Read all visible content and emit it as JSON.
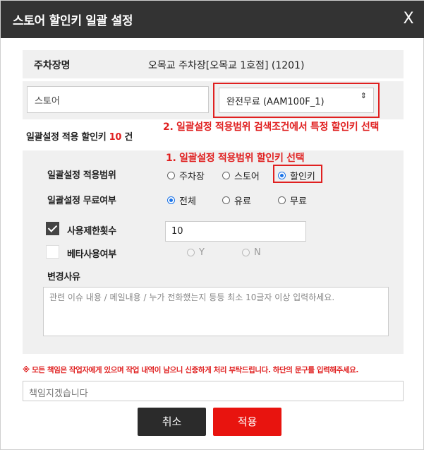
{
  "dialog": {
    "title": "스토어 할인키 일괄 설정",
    "close_label": "X"
  },
  "parking_lot": {
    "label": "주차장명",
    "value": "오목교 주차장[오목교 1호점] (1201)"
  },
  "filter": {
    "store_input_value": "스토어",
    "discount_select_value": "완전무료 (AAM100F_1)",
    "select_arrow": "⇕"
  },
  "annotations": {
    "step2": "2. 일괄설정 적용범위 검색조건에서 특정 할인키 선택",
    "step1": "1. 일괄설정 적용범위 할인키 선택"
  },
  "count": {
    "prefix": "일괄설정 적용 할인키",
    "number": "10",
    "suffix": "건"
  },
  "scope": {
    "label": "일괄설정 적용범위",
    "options": [
      "주차장",
      "스토어",
      "할인키"
    ],
    "selected": "할인키"
  },
  "free_type": {
    "label": "일괄설정 무료여부",
    "options": [
      "전체",
      "유료",
      "무료"
    ],
    "selected": "전체"
  },
  "usage_limit": {
    "label": "사용제한횟수",
    "checked": true,
    "value": "10"
  },
  "beta": {
    "label": "베타사용여부",
    "checked": false,
    "options": [
      "Y",
      "N"
    ]
  },
  "reason": {
    "label": "변경사유",
    "placeholder": "관련 이슈 내용 / 메일내용 / 누가 전화했는지 등등 최소 10글자 이상 입력하세요."
  },
  "warning": "※ 모든 책임은 작업자에게 있으며 작업 내역이 남으니 신중하게 처리 부탁드립니다. 하단의 문구를 입력해주세요.",
  "confirm": {
    "placeholder": "책임지겠습니다"
  },
  "buttons": {
    "cancel": "취소",
    "apply": "적용"
  },
  "colors": {
    "header": "#333333",
    "accent": "#e02020",
    "apply": "#e8140f",
    "cancel": "#2b2b2b",
    "radio": "#1a73e8"
  }
}
